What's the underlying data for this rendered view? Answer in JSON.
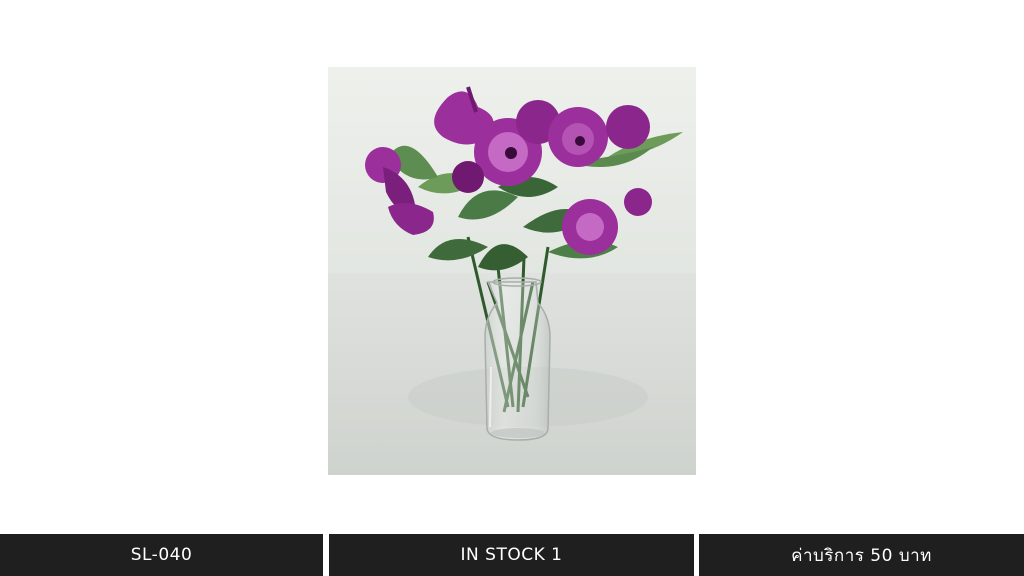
{
  "product_image": {
    "icon": "pansy-bouquet-in-glass-vase",
    "colors": {
      "wall": "#e8ebe7",
      "table": "#d9dcd8",
      "petal": "#9b2f9b",
      "petal_dark": "#6f1a70",
      "petal_light": "#c46ac4",
      "leaf": "#3f6b3c",
      "leaf_light": "#6d9b5a",
      "stem": "#2f5a2c"
    }
  },
  "footer": {
    "sku": "SL-040",
    "stock": "IN STOCK 1",
    "price": "ค่าบริการ 50 บาท"
  }
}
